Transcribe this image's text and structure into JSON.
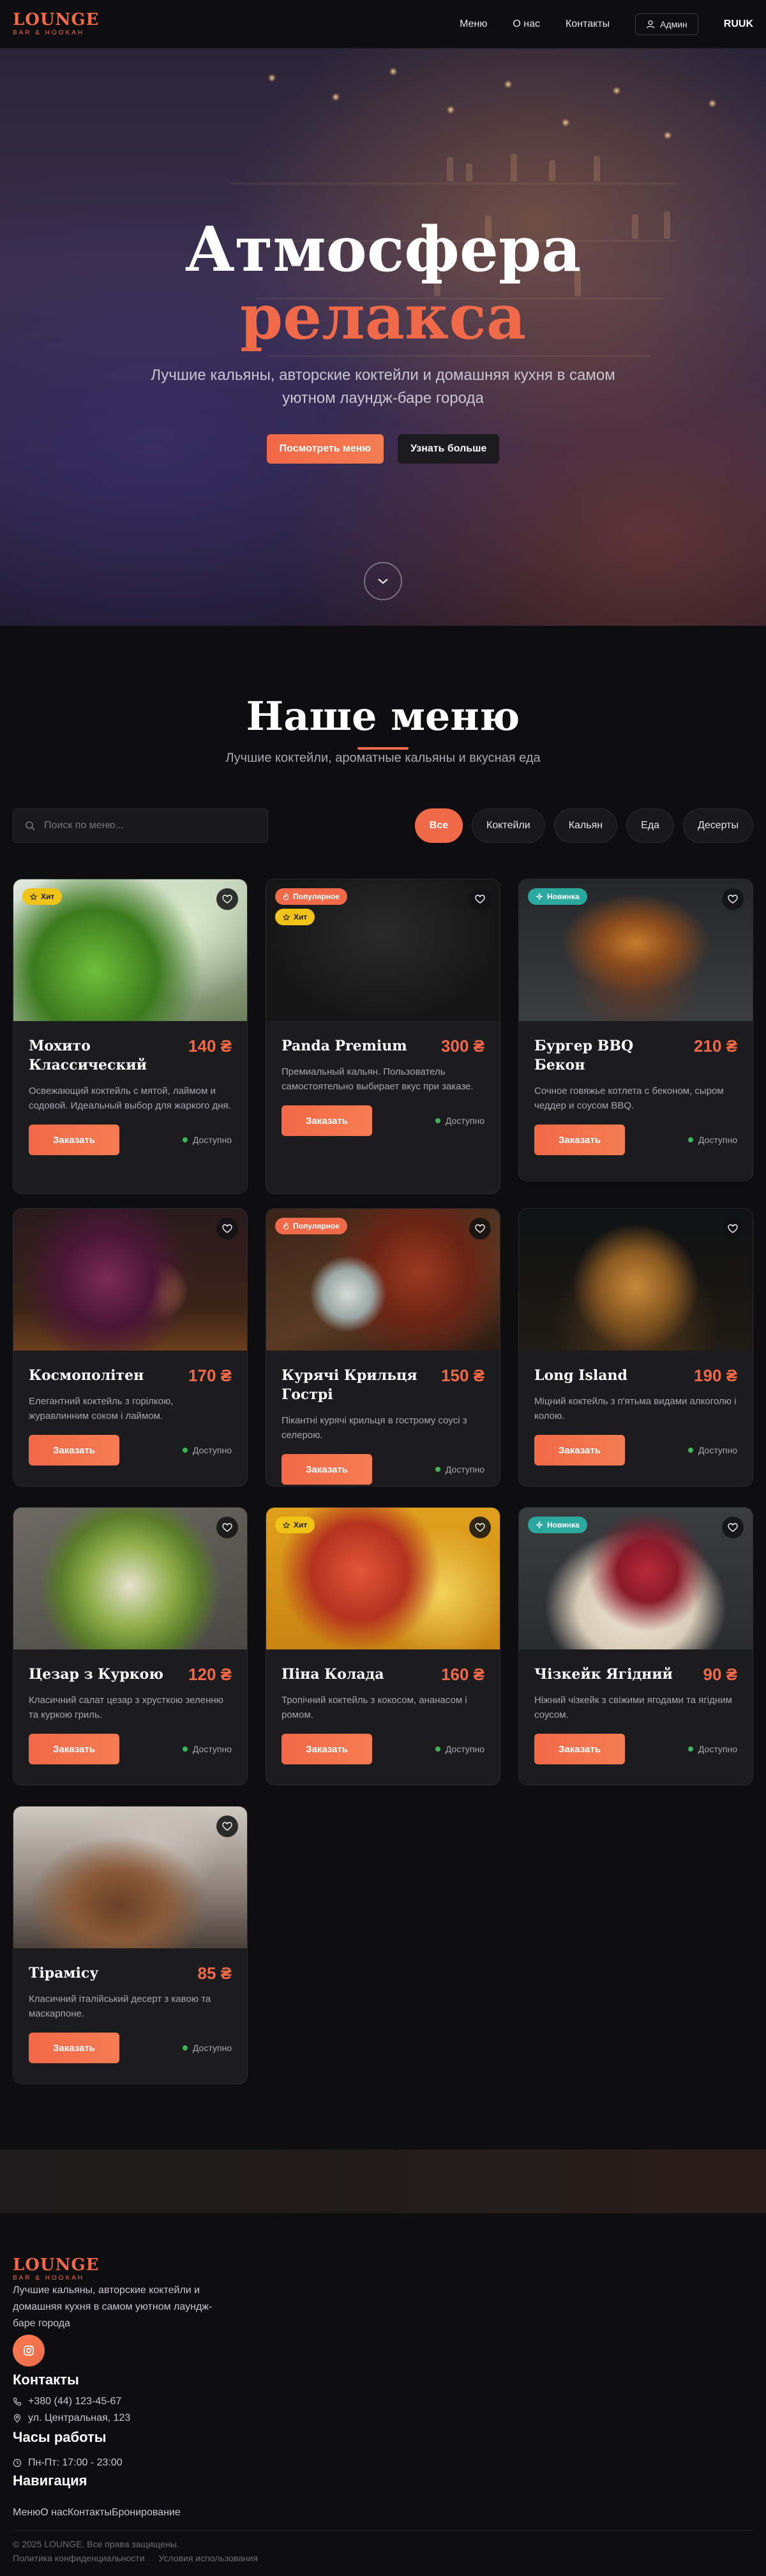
{
  "header": {
    "logo_title": "LOUNGE",
    "logo_subtitle": "BAR & HOOKAH",
    "nav": [
      "Меню",
      "О нас",
      "Контакты"
    ],
    "admin_label": "Админ",
    "lang_label": "RUUK"
  },
  "hero": {
    "title_line1": "Атмосфера",
    "title_line2": "релакса",
    "subtitle": "Лучшие кальяны, авторские коктейли и домашняя кухня в самом уютном лаундж-баре города",
    "primary_button": "Посмотреть меню",
    "secondary_button": "Узнать больше"
  },
  "menu": {
    "title": "Наше меню",
    "subtitle": "Лучшие коктейли, ароматные кальяны и вкусная еда",
    "search_placeholder": "Поиск по меню...",
    "filters": [
      "Все",
      "Коктейли",
      "Кальян",
      "Еда",
      "Десерты"
    ],
    "active_filter": "Все",
    "order_label": "Заказать",
    "status_label": "Доступно",
    "items": [
      {
        "name": "Мохито Классический",
        "price": "140 ₴",
        "desc": "Освежающий коктейль с мятой, лаймом и содовой. Идеальный выбор для жаркого дня.",
        "badges": [
          {
            "type": "hit",
            "label": "Хит"
          }
        ],
        "image": "mojito-photo"
      },
      {
        "name": "Panda Premium",
        "price": "300 ₴",
        "desc": "Премиальный кальян. Пользователь самостоятельно выбирает вкус при заказе.",
        "badges": [
          {
            "type": "popular",
            "label": "Популярное"
          },
          {
            "type": "hit",
            "label": "Хит"
          }
        ],
        "image": "dark-texture-photo"
      },
      {
        "name": "Бургер BBQ Бекон",
        "price": "210 ₴",
        "desc": "Сочное говяжье котлета с беконом, сыром чеддер и соусом BBQ.",
        "badges": [
          {
            "type": "new",
            "label": "Новинка"
          }
        ],
        "image": "burger-photo"
      },
      {
        "name": "Космополітен",
        "price": "170 ₴",
        "desc": "Елегантний коктейль з горілкою, журавлинним соком і лаймом.",
        "badges": [],
        "image": "cosmopolitan-photo"
      },
      {
        "name": "Курячі Крильця Гострі",
        "price": "150 ₴",
        "desc": "Пікантні курячі крильця в гострому соусі з селерою.",
        "badges": [
          {
            "type": "popular",
            "label": "Популярное"
          }
        ],
        "image": "wings-photo"
      },
      {
        "name": "Long Island",
        "price": "190 ₴",
        "desc": "Міцний коктейль з п'ятьма видами алкоголю і колою.",
        "badges": [],
        "image": "long-island-photo"
      },
      {
        "name": "Цезар з Куркою",
        "price": "120 ₴",
        "desc": "Класичний салат цезар з хрусткою зеленню та куркою гриль.",
        "badges": [],
        "image": "salad-photo"
      },
      {
        "name": "Піна Колада",
        "price": "160 ₴",
        "desc": "Тропічний коктейль з кокосом, ананасом і ромом.",
        "badges": [
          {
            "type": "hit",
            "label": "Хит"
          }
        ],
        "image": "pina-colada-photo"
      },
      {
        "name": "Чізкейк Ягідний",
        "price": "90 ₴",
        "desc": "Ніжний чізкейк з свіжими ягодами та ягідним соусом.",
        "badges": [
          {
            "type": "new",
            "label": "Новинка"
          }
        ],
        "image": "cheesecake-photo"
      },
      {
        "name": "Тірамісу",
        "price": "85 ₴",
        "desc": "Класичний італійський десерт з кавою та маскарпоне.",
        "badges": [],
        "image": "tiramisu-photo"
      }
    ]
  },
  "footer": {
    "logo_title": "LOUNGE",
    "logo_subtitle": "BAR & HOOKAH",
    "description": "Лучшие кальяны, авторские коктейли и домашняя кухня в самом уютном лаундж-баре города",
    "contacts_title": "Контакты",
    "phone": "+380 (44) 123-45-67",
    "address": "ул. Центральная, 123",
    "hours_title": "Часы работы",
    "hours": "Пн-Пт: 17:00 - 23:00",
    "nav_title": "Навигация",
    "nav_links": [
      "Меню",
      "О нас",
      "Контакты",
      "Бронирование"
    ],
    "copyright": "© 2025 LOUNGE. Все права защищены.",
    "privacy": "Политика конфиденциальности",
    "terms": "Условия использования"
  },
  "colors": {
    "accent": "#f06a4a",
    "hit": "#f0c417",
    "new": "#2ba9a0",
    "available": "#3fb45a",
    "background": "#0e0e10",
    "card": "#1c1c1f"
  }
}
